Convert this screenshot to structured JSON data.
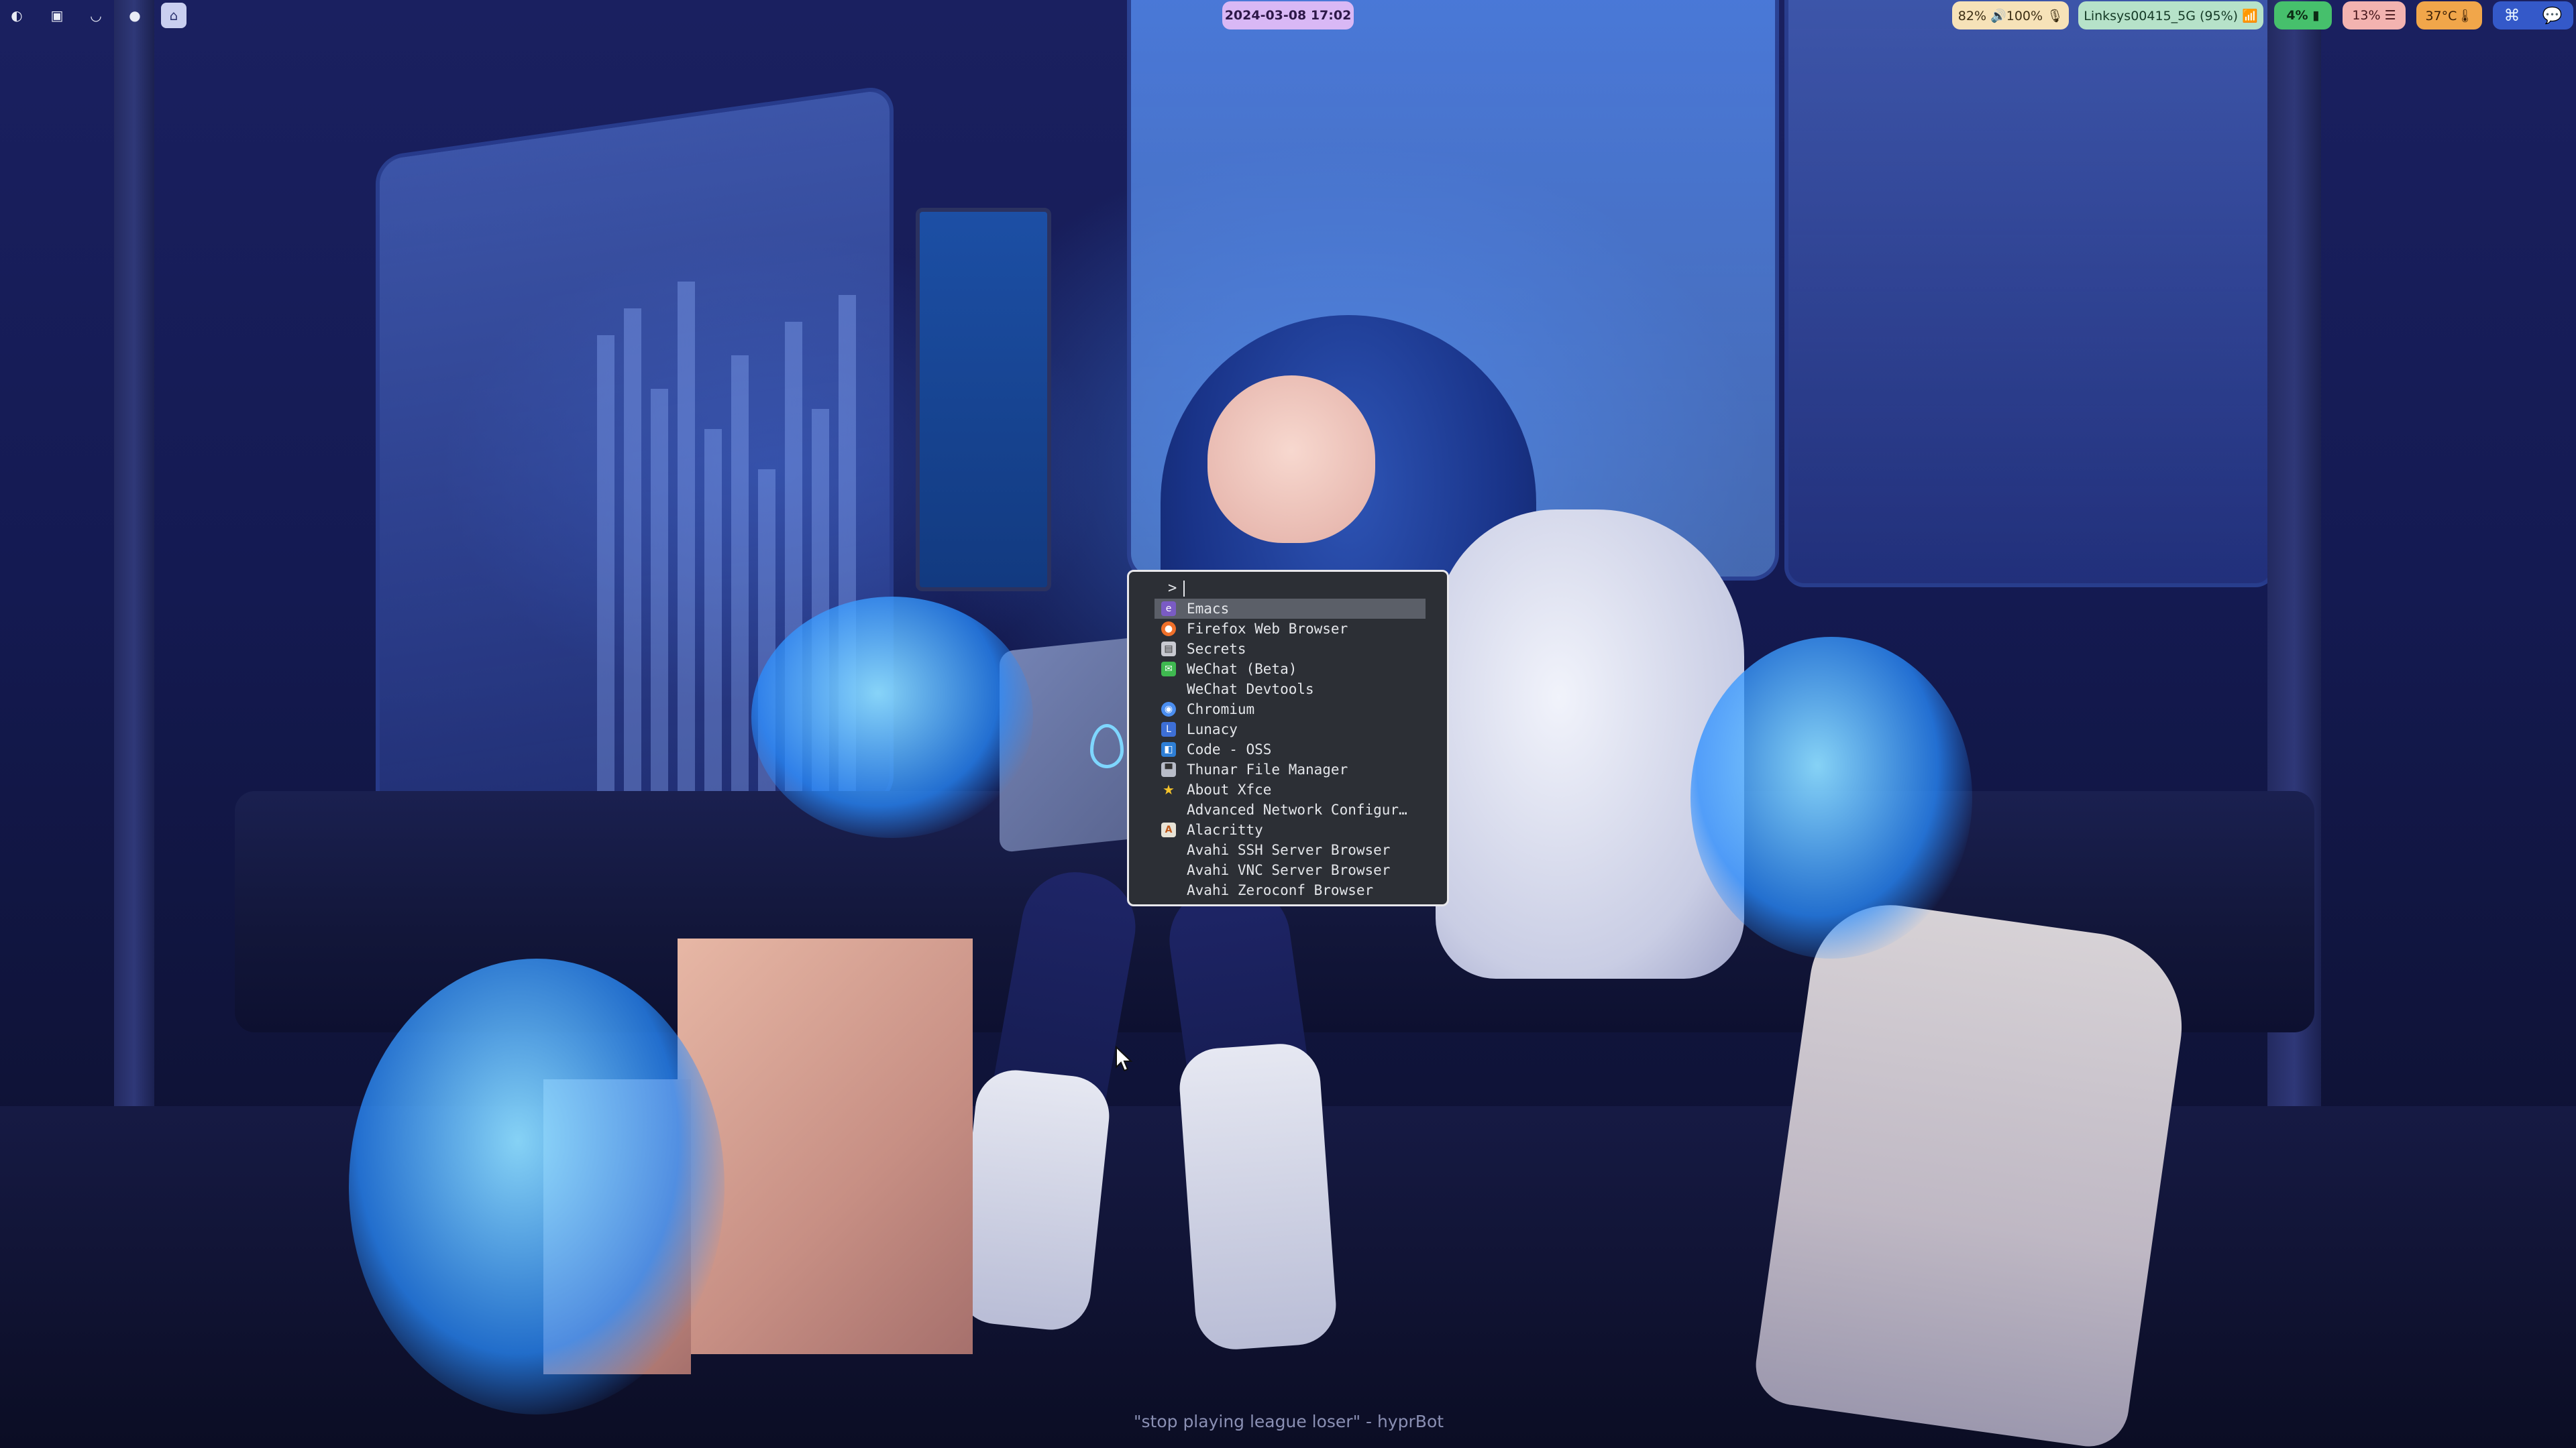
{
  "colors": {
    "clock_bg": "#d9b8f5",
    "audio_bg": "#f6e2b8",
    "network_bg": "#b6e2c9",
    "cpu_bg": "#46c06c",
    "memory_bg": "#f3b3b0",
    "temp_bg": "#f1a64a",
    "tray_bg": "#3459c9",
    "launcher_bg": "#2c2f35",
    "launcher_selected": "#5b5f68"
  },
  "topbar": {
    "workspaces": [
      {
        "icon": "emacs-icon"
      },
      {
        "icon": "terminal-icon"
      },
      {
        "icon": "browser-icon"
      },
      {
        "icon": "chat-icon"
      },
      {
        "icon": "home-icon",
        "active": true
      }
    ],
    "clock": "2024-03-08 17:02",
    "audio": "82% 🔊100% 🎙",
    "network": "Linksys00415_5G (95%) 📶",
    "cpu": "4% ▮",
    "memory": "13% ☰",
    "temperature": "37°C🌡",
    "tray_icons": [
      "blender-icon",
      "wechat-icon"
    ]
  },
  "launcher": {
    "prompt": ">",
    "items": [
      {
        "label": "Emacs",
        "icon": "emacs-icon",
        "selected": true
      },
      {
        "label": "Firefox Web Browser",
        "icon": "firefox-icon"
      },
      {
        "label": "Secrets",
        "icon": "secrets-icon"
      },
      {
        "label": "WeChat (Beta)",
        "icon": "wechat-icon"
      },
      {
        "label": "WeChat Devtools",
        "icon": ""
      },
      {
        "label": "Chromium",
        "icon": "chromium-icon"
      },
      {
        "label": "Lunacy",
        "icon": "lunacy-icon"
      },
      {
        "label": "Code - OSS",
        "icon": "code-oss-icon"
      },
      {
        "label": "Thunar File Manager",
        "icon": "thunar-icon"
      },
      {
        "label": "About Xfce",
        "icon": "xfce-star-icon"
      },
      {
        "label": "Advanced Network Configur…",
        "icon": ""
      },
      {
        "label": "Alacritty",
        "icon": "alacritty-icon"
      },
      {
        "label": "Avahi SSH Server Browser",
        "icon": ""
      },
      {
        "label": "Avahi VNC Server Browser",
        "icon": ""
      },
      {
        "label": "Avahi Zeroconf Browser",
        "icon": ""
      }
    ]
  },
  "wallpaper_quote": "\"stop playing league loser\" - hyprBot"
}
